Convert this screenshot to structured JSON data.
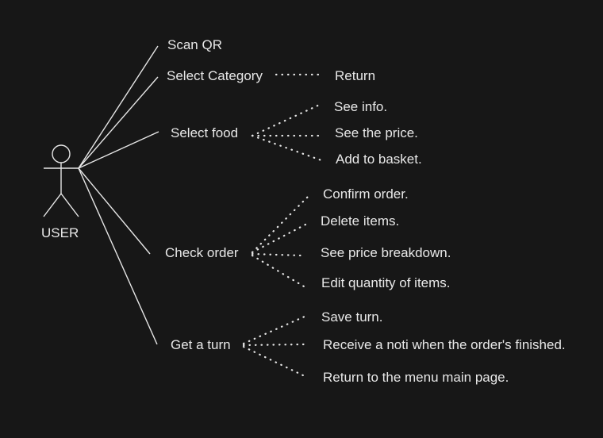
{
  "actor": {
    "label": "USER"
  },
  "use_cases": [
    {
      "id": "scan_qr",
      "label": "Scan QR"
    },
    {
      "id": "select_category",
      "label": "Select Category"
    },
    {
      "id": "select_food",
      "label": "Select food"
    },
    {
      "id": "check_order",
      "label": "Check order"
    },
    {
      "id": "get_turn",
      "label": "Get a turn"
    }
  ],
  "sub_cases": {
    "select_category": [
      "Return"
    ],
    "select_food": [
      "See info.",
      "See the price.",
      "Add to basket."
    ],
    "check_order": [
      "Confirm order.",
      "Delete items.",
      "See price breakdown.",
      "Edit quantity of items."
    ],
    "get_turn": [
      "Save turn.",
      "Receive a noti when the order's finished.",
      "Return to the menu main page."
    ]
  },
  "colors": {
    "background": "#171717",
    "foreground": "#e6e6e6"
  }
}
